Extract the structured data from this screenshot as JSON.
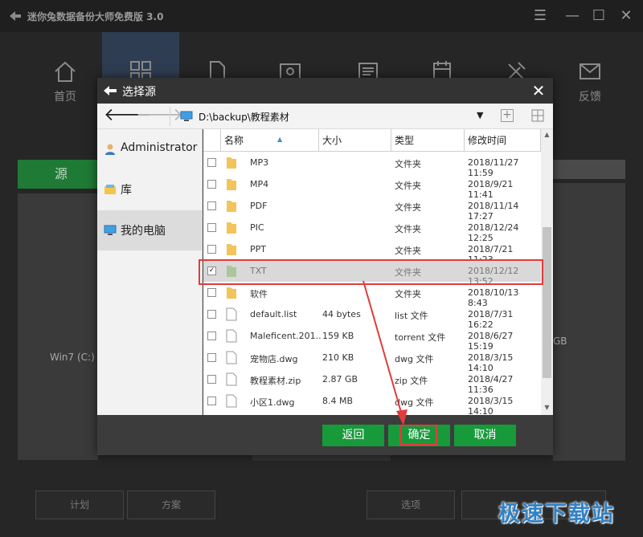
{
  "app": {
    "title": "迷你兔数据备份大师免费版 3.0",
    "nav": [
      {
        "label": "首页",
        "icon": "home-icon"
      },
      {
        "label": "",
        "icon": "backup-icon"
      },
      {
        "label": "",
        "icon": "file-icon"
      },
      {
        "label": "",
        "icon": "disk-icon"
      },
      {
        "label": "",
        "icon": "manage-icon"
      },
      {
        "label": "",
        "icon": "calendar-icon"
      },
      {
        "label": "",
        "icon": "tools-icon"
      },
      {
        "label": "反馈",
        "icon": "mail-icon"
      }
    ],
    "source_header": "源",
    "source_item": "Win7 (C:) N",
    "dest_fragment": "GB",
    "bottom_buttons": [
      "计划",
      "方案",
      "选项",
      ""
    ]
  },
  "dialog": {
    "title": "选择源",
    "path": "D:\\backup\\教程素材",
    "sidebar": [
      {
        "label": "Administrator",
        "icon": "user-icon"
      },
      {
        "label": "库",
        "icon": "library-icon"
      },
      {
        "label": "我的电脑",
        "icon": "computer-icon"
      }
    ],
    "columns": [
      "名称",
      "大小",
      "类型",
      "修改时间"
    ],
    "rows": [
      {
        "name": "MP3",
        "size": "",
        "type": "文件夹",
        "date": "2018/11/27 11:59",
        "checked": false,
        "kind": "folder"
      },
      {
        "name": "MP4",
        "size": "",
        "type": "文件夹",
        "date": "2018/9/21 11:41",
        "checked": false,
        "kind": "folder"
      },
      {
        "name": "PDF",
        "size": "",
        "type": "文件夹",
        "date": "2018/11/14 17:27",
        "checked": false,
        "kind": "folder"
      },
      {
        "name": "PIC",
        "size": "",
        "type": "文件夹",
        "date": "2018/12/24 12:25",
        "checked": false,
        "kind": "folder"
      },
      {
        "name": "PPT",
        "size": "",
        "type": "文件夹",
        "date": "2018/7/21 11:23",
        "checked": false,
        "kind": "folder"
      },
      {
        "name": "TXT",
        "size": "",
        "type": "文件夹",
        "date": "2018/12/12 13:52",
        "checked": true,
        "kind": "folder"
      },
      {
        "name": "软件",
        "size": "",
        "type": "文件夹",
        "date": "2018/10/13 8:43",
        "checked": false,
        "kind": "folder"
      },
      {
        "name": "default.list",
        "size": "44 bytes",
        "type": "list 文件",
        "date": "2018/7/31 16:22",
        "checked": false,
        "kind": "file"
      },
      {
        "name": "Maleficent.201...",
        "size": "159 KB",
        "type": "torrent 文件",
        "date": "2018/6/27 15:19",
        "checked": false,
        "kind": "file"
      },
      {
        "name": "宠物店.dwg",
        "size": "210 KB",
        "type": "dwg 文件",
        "date": "2018/3/15 14:10",
        "checked": false,
        "kind": "file"
      },
      {
        "name": "教程素材.zip",
        "size": "2.87 GB",
        "type": "zip 文件",
        "date": "2018/4/27 11:36",
        "checked": false,
        "kind": "file"
      },
      {
        "name": "小区1.dwg",
        "size": "8.4 MB",
        "type": "dwg 文件",
        "date": "2018/3/15 14:10",
        "checked": false,
        "kind": "file"
      }
    ],
    "buttons": {
      "back": "返回",
      "ok": "确定",
      "cancel": "取消"
    }
  },
  "watermark": "极速下载站",
  "colors": {
    "accent_green": "#179a3a",
    "highlight_red": "#e23b3b",
    "nav_active": "#2e3d52"
  }
}
